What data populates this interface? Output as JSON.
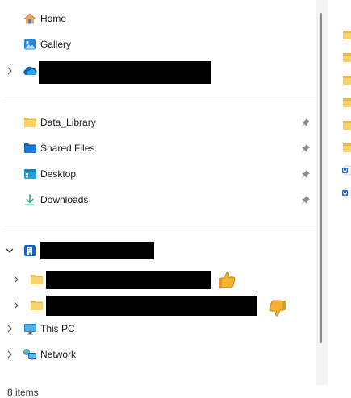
{
  "quick": {
    "home": "Home",
    "gallery": "Gallery"
  },
  "pinned": {
    "data_library": "Data_Library",
    "shared_files": "Shared Files",
    "desktop": "Desktop",
    "downloads": "Downloads"
  },
  "tree": {
    "this_pc": "This PC",
    "network": "Network"
  },
  "status": {
    "items": "8 items"
  },
  "colors": {
    "folder_yellow": "#f7c948",
    "accent_blue": "#0f6cbd",
    "redaction": "#000000"
  },
  "icons": [
    "home-icon",
    "gallery-icon",
    "onedrive-icon",
    "folder-icon",
    "blue-folder-icon",
    "desktop-icon",
    "download-icon",
    "pin-icon",
    "building-icon",
    "this-pc-icon",
    "network-icon",
    "thumbs-up-icon",
    "thumbs-down-icon",
    "word-file-icon"
  ]
}
